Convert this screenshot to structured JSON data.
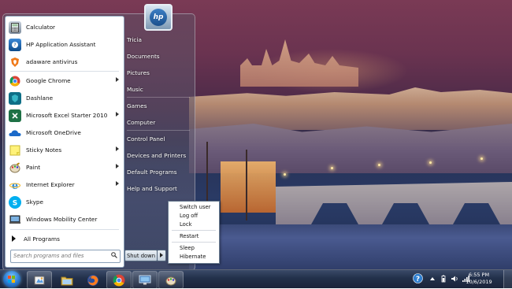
{
  "start_menu": {
    "programs": [
      {
        "label": "Calculator",
        "icon": "calculator-icon"
      },
      {
        "label": "HP Application Assistant",
        "icon": "hp-assistant-icon"
      },
      {
        "label": "adaware antivirus",
        "icon": "adaware-icon"
      },
      {
        "label": "Google Chrome",
        "icon": "chrome-icon",
        "submenu": true
      },
      {
        "label": "Dashlane",
        "icon": "dashlane-icon"
      },
      {
        "label": "Microsoft Excel Starter 2010",
        "icon": "excel-icon",
        "submenu": true
      },
      {
        "label": "Microsoft OneDrive",
        "icon": "onedrive-icon"
      },
      {
        "label": "Sticky Notes",
        "icon": "sticky-notes-icon",
        "submenu": true
      },
      {
        "label": "Paint",
        "icon": "paint-icon",
        "submenu": true
      },
      {
        "label": "Internet Explorer",
        "icon": "internet-explorer-icon",
        "submenu": true
      },
      {
        "label": "Skype",
        "icon": "skype-icon"
      },
      {
        "label": "Windows Mobility Center",
        "icon": "mobility-center-icon"
      }
    ],
    "all_programs_label": "All Programs",
    "search_placeholder": "Search programs and files",
    "user_logo_text": "hp",
    "right_links": [
      "Tricia",
      "Documents",
      "Pictures",
      "Music",
      "Games",
      "Computer",
      "Control Panel",
      "Devices and Printers",
      "Default Programs",
      "Help and Support"
    ],
    "shutdown_label": "Shut down",
    "shutdown_menu": [
      "Switch user",
      "Log off",
      "Lock",
      "Restart",
      "Sleep",
      "Hibernate"
    ]
  },
  "taskbar": {
    "pinned": [
      "paint-icon",
      "windows-explorer-icon",
      "firefox-icon",
      "chrome-icon",
      "remote-desktop-icon",
      "paint-palette-icon"
    ],
    "clock_time": "6:55 PM",
    "clock_date": "10/6/2019"
  },
  "colors": {
    "taskbar": "#22304a",
    "start_orb": "#2a7ad0",
    "menu_white": "#ffffff"
  }
}
